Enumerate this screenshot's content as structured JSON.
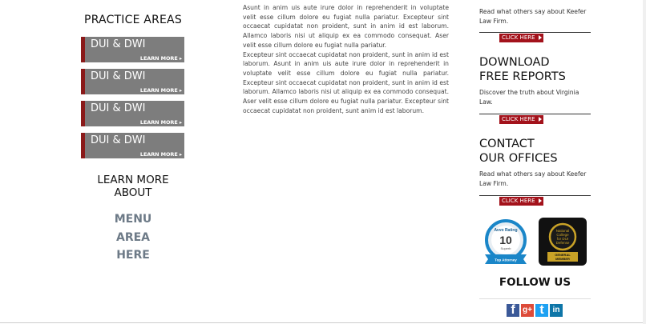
{
  "left": {
    "practice_title": "PRACTICE AREAS",
    "buttons": [
      {
        "label": "DUI & DWI",
        "sub": "LEARN MORE"
      },
      {
        "label": "DUI & DWI",
        "sub": "LEARN MORE"
      },
      {
        "label": "DUI & DWI",
        "sub": "LEARN MORE"
      },
      {
        "label": "DUI & DWI",
        "sub": "LEARN MORE"
      }
    ],
    "learn_title": "LEARN MORE ABOUT",
    "menu_lines": [
      "MENU",
      "AREA",
      "HERE"
    ]
  },
  "middle": {
    "paragraphs": [
      "Asunt in anim uis aute irure dolor in reprehenderit in voluptate velit esse cillum dolore eu fugiat nulla pariatur. Excepteur sint occaecat cupidatat non proident, sunt in anim id est laborum. Allamco laboris nisi ut aliquip ex ea commodo consequat. Aser velit esse cillum dolore eu fugiat nulla pariatur.",
      "Excepteur sint occaecat cupidatat non proident, sunt in anim id est laborum. Asunt in anim uis aute irure dolor in reprehenderit in voluptate velit esse cillum dolore eu fugiat nulla pariatur. Excepteur sint occaecat cupidatat non proident, sunt in anim id est laborum. Allamco laboris nisi ut aliquip ex ea commodo consequat. Aser velit esse cillum dolore eu fugiat nulla pariatur. Excepteur sint occaecat cupidatat non proident, sunt anim id est laborum."
    ]
  },
  "right": {
    "top_text": "Read what others say about Keefer Law Firm.",
    "click_here": "CLICK HERE",
    "reports_title_1": "DOWNLOAD",
    "reports_title_2": "FREE REPORTS",
    "reports_text": "Discover the truth about Virginia Law.",
    "contact_title_1": "CONTACT",
    "contact_title_2": "OUR OFFICES",
    "contact_text": "Read what others say about Keefer Law Firm.",
    "avvo": {
      "brand": "Avvo",
      "rating_label": "Rating",
      "score": "10",
      "grade": "Superb",
      "banner": "Top Attorney"
    },
    "ncdd": {
      "line1": "National",
      "line2": "College",
      "line3": "for DUI",
      "line4": "Defense",
      "banner1": "GENERAL",
      "banner2": "MEMBER"
    },
    "follow_title": "FOLLOW US",
    "social": [
      {
        "name": "facebook",
        "glyph": "f",
        "color": "#3b5998"
      },
      {
        "name": "google-plus",
        "glyph": "g+",
        "color": "#dd4b39"
      },
      {
        "name": "twitter",
        "glyph": "t",
        "color": "#1da1f2"
      },
      {
        "name": "linkedin",
        "glyph": "in",
        "color": "#0e76a8"
      }
    ]
  }
}
